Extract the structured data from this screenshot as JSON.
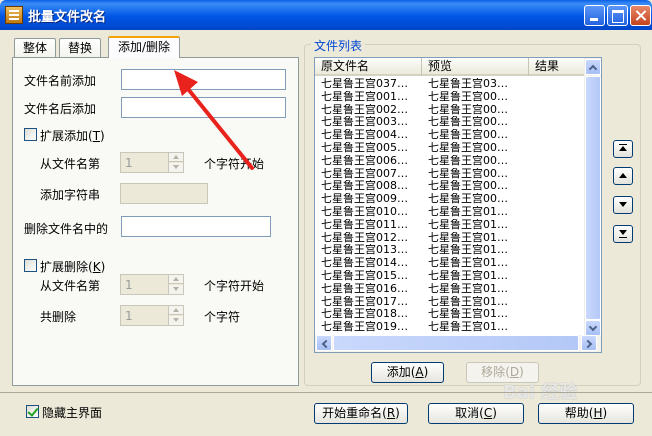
{
  "window": {
    "title": "批量文件改名",
    "title_buttons": [
      "minimize-icon",
      "maximize-icon",
      "close-icon"
    ]
  },
  "tabs": [
    {
      "label": "整体",
      "active": false
    },
    {
      "label": "替换",
      "active": false
    },
    {
      "label": "添加/删除",
      "active": true
    }
  ],
  "panel": {
    "prefix_label": "文件名前添加",
    "prefix_value": "",
    "suffix_label": "文件名后添加",
    "suffix_value": "",
    "extend_add_label": "扩展添加",
    "extend_add_hotkey": "T",
    "extend_add_checked": false,
    "from_pos_label": "从文件名第",
    "from_pos_value": "1",
    "char_start_label": "个字符开始",
    "add_string_label": "添加字符串",
    "add_string_value": "",
    "delete_in_name_label": "删除文件名中的",
    "delete_in_name_value": "",
    "extend_delete_label": "扩展删除",
    "extend_delete_hotkey": "K",
    "extend_delete_checked": false,
    "del_from_label": "从文件名第",
    "del_from_value": "1",
    "del_char_start_label": "个字符开始",
    "del_total_label": "共删除",
    "del_total_value": "1",
    "del_chars_label": "个字符"
  },
  "file_list": {
    "group_title": "文件列表",
    "columns": [
      "原文件名",
      "预览",
      "结果"
    ],
    "rows": [
      [
        "七星鲁王宫037…",
        "七星鲁王宫03…",
        ""
      ],
      [
        "七星鲁王宫001…",
        "七星鲁王宫00…",
        ""
      ],
      [
        "七星鲁王宫002…",
        "七星鲁王宫00…",
        ""
      ],
      [
        "七星鲁王宫003…",
        "七星鲁王宫00…",
        ""
      ],
      [
        "七星鲁王宫004…",
        "七星鲁王宫00…",
        ""
      ],
      [
        "七星鲁王宫005…",
        "七星鲁王宫00…",
        ""
      ],
      [
        "七星鲁王宫006…",
        "七星鲁王宫00…",
        ""
      ],
      [
        "七星鲁王宫007…",
        "七星鲁王宫00…",
        ""
      ],
      [
        "七星鲁王宫008…",
        "七星鲁王宫00…",
        ""
      ],
      [
        "七星鲁王宫009…",
        "七星鲁王宫00…",
        ""
      ],
      [
        "七星鲁王宫010…",
        "七星鲁王宫01…",
        ""
      ],
      [
        "七星鲁王宫011…",
        "七星鲁王宫01…",
        ""
      ],
      [
        "七星鲁王宫012…",
        "七星鲁王宫01…",
        ""
      ],
      [
        "七星鲁王宫013…",
        "七星鲁王宫01…",
        ""
      ],
      [
        "七星鲁王宫014…",
        "七星鲁王宫01…",
        ""
      ],
      [
        "七星鲁王宫015…",
        "七星鲁王宫01…",
        ""
      ],
      [
        "七星鲁王宫016…",
        "七星鲁王宫01…",
        ""
      ],
      [
        "七星鲁王宫017…",
        "七星鲁王宫01…",
        ""
      ],
      [
        "七星鲁王宫018…",
        "七星鲁王宫01…",
        ""
      ],
      [
        "七星鲁王宫019…",
        "七星鲁王宫01…",
        ""
      ]
    ],
    "add_button": "添加",
    "add_hotkey": "A",
    "remove_button": "移除",
    "remove_hotkey": "D",
    "move_buttons": [
      "move-top-icon",
      "move-up-icon",
      "move-down-icon",
      "move-bottom-icon"
    ]
  },
  "footer": {
    "hide_main_label": "隐藏主界面",
    "hide_main_checked": true,
    "start_button": "开始重命名",
    "start_hotkey": "R",
    "cancel_button": "取消",
    "cancel_hotkey": "C",
    "help_button": "帮助",
    "help_hotkey": "H"
  },
  "annotation": {
    "color": "#e8221c"
  },
  "watermark": "Bai 经验"
}
